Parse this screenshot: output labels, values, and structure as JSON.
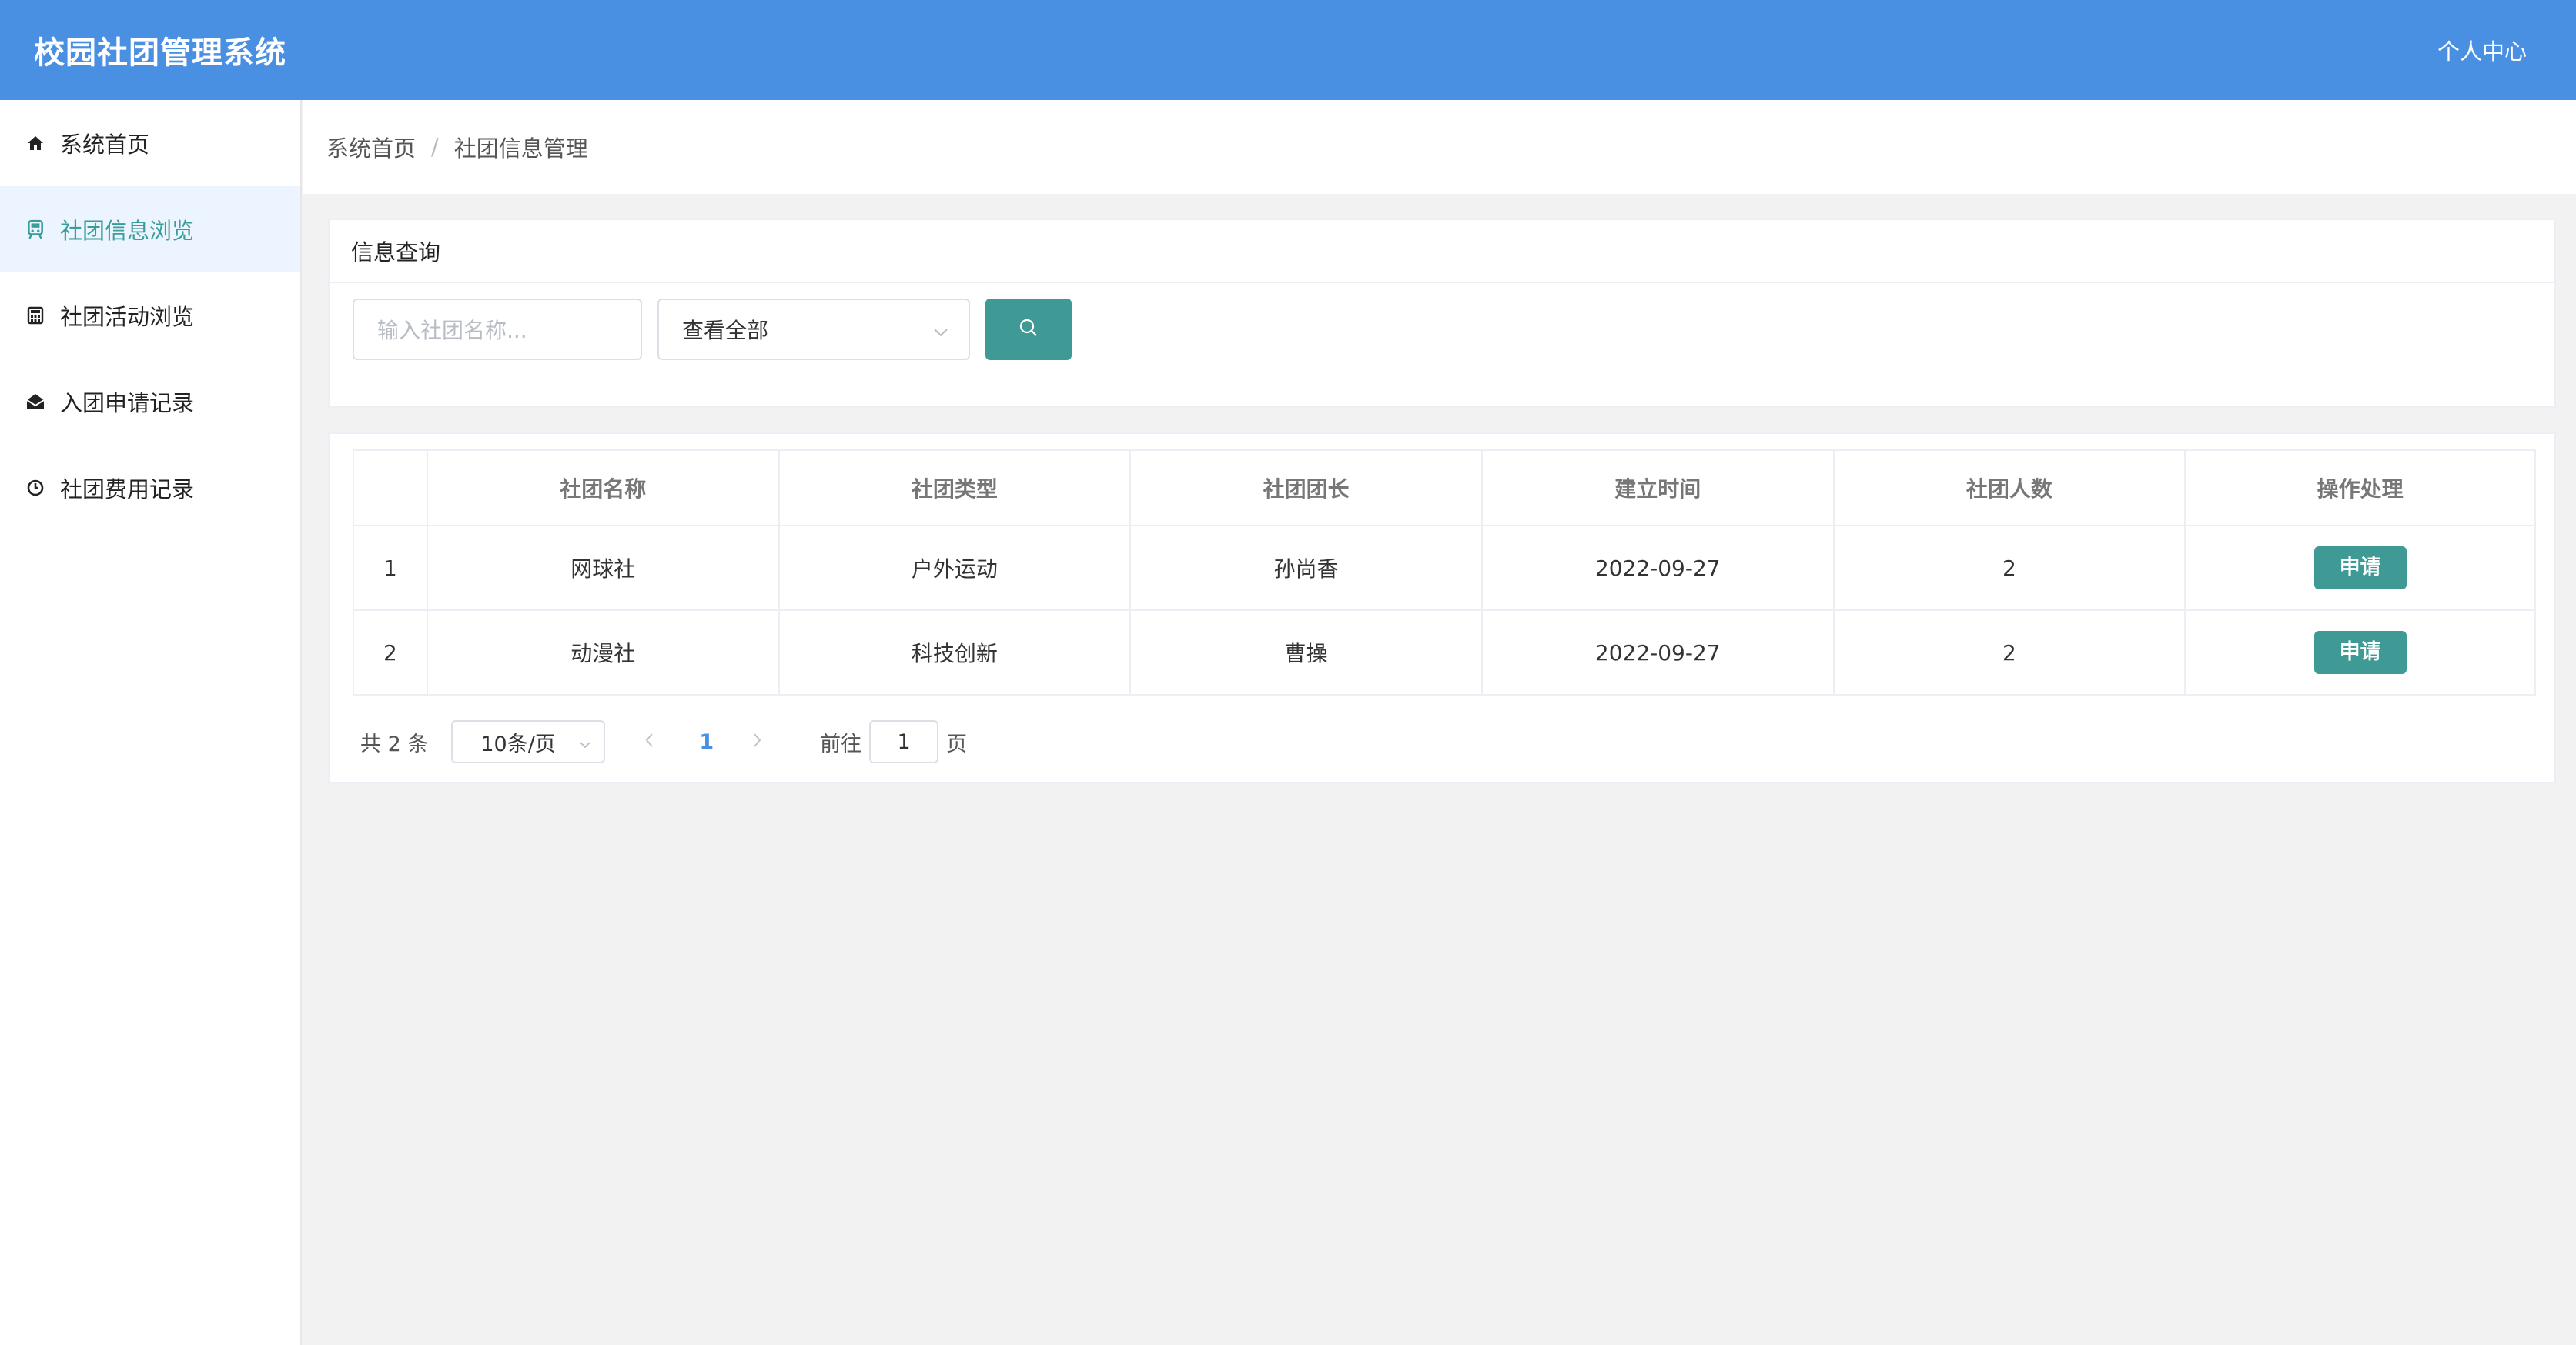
{
  "header": {
    "title": "校园社团管理系统",
    "profile": "个人中心"
  },
  "sidebar": {
    "items": [
      {
        "label": "系统首页",
        "icon": "home-icon",
        "active": false
      },
      {
        "label": "社团信息浏览",
        "icon": "train-icon",
        "active": true
      },
      {
        "label": "社团活动浏览",
        "icon": "calculator-icon",
        "active": false
      },
      {
        "label": "入团申请记录",
        "icon": "envelope-open-icon",
        "active": false
      },
      {
        "label": "社团费用记录",
        "icon": "clock-icon",
        "active": false
      }
    ]
  },
  "breadcrumb": {
    "home": "系统首页",
    "current": "社团信息管理",
    "separator": "/"
  },
  "search": {
    "panel_title": "信息查询",
    "placeholder": "输入社团名称...",
    "select_value": "查看全部"
  },
  "table": {
    "columns": [
      "",
      "社团名称",
      "社团类型",
      "社团团长",
      "建立时间",
      "社团人数",
      "操作处理"
    ],
    "rows": [
      {
        "index": "1",
        "name": "网球社",
        "type": "户外运动",
        "leader": "孙尚香",
        "date": "2022-09-27",
        "count": "2",
        "action": "申请"
      },
      {
        "index": "2",
        "name": "动漫社",
        "type": "科技创新",
        "leader": "曹操",
        "date": "2022-09-27",
        "count": "2",
        "action": "申请"
      }
    ]
  },
  "pagination": {
    "total_text": "共 2 条",
    "page_size": "10条/页",
    "current_page": "1",
    "goto_label": "前往",
    "goto_value": "1",
    "page_suffix": "页"
  },
  "colors": {
    "header": "#4a90e2",
    "accent": "#3f9a96",
    "active_bg": "#ecf5ff"
  }
}
